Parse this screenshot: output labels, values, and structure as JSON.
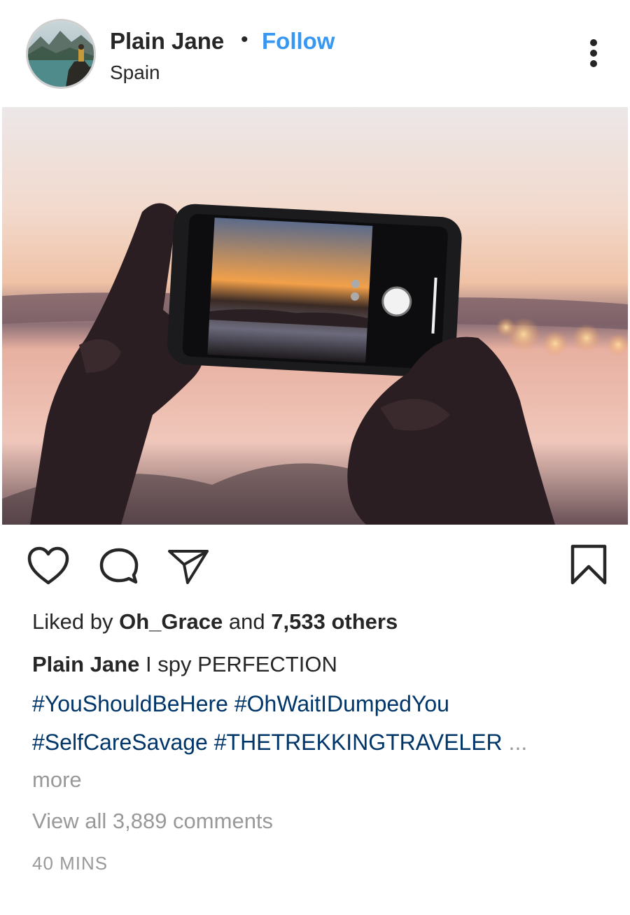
{
  "header": {
    "username": "Plain Jane",
    "separator": "•",
    "follow_label": "Follow",
    "location": "Spain",
    "menu_icon": "more-vertical-icon"
  },
  "post": {
    "image_icon": "photo-of-hands-holding-phone-at-sunset"
  },
  "actions": {
    "like_icon": "heart-icon",
    "comment_icon": "comment-icon",
    "share_icon": "send-icon",
    "save_icon": "bookmark-icon"
  },
  "likes": {
    "prefix": "Liked by",
    "liker": "Oh_Grace",
    "middle": "and",
    "others": "7,533 others"
  },
  "caption": {
    "user": "Plain Jane",
    "text": "I spy PERFECTION",
    "tags_line1": "#YouShouldBeHere #OhWaitIDumpedYou",
    "tags_line2": "#SelfCareSavage #THETREKKINGTRAVELER",
    "ellipsis": "...",
    "more": "more"
  },
  "comments": {
    "view_all": "View all 3,889 comments"
  },
  "timestamp": "40 MINS",
  "colors": {
    "follow": "#3897f0",
    "hashtag": "#003569",
    "muted": "#999999",
    "text": "#262626"
  }
}
